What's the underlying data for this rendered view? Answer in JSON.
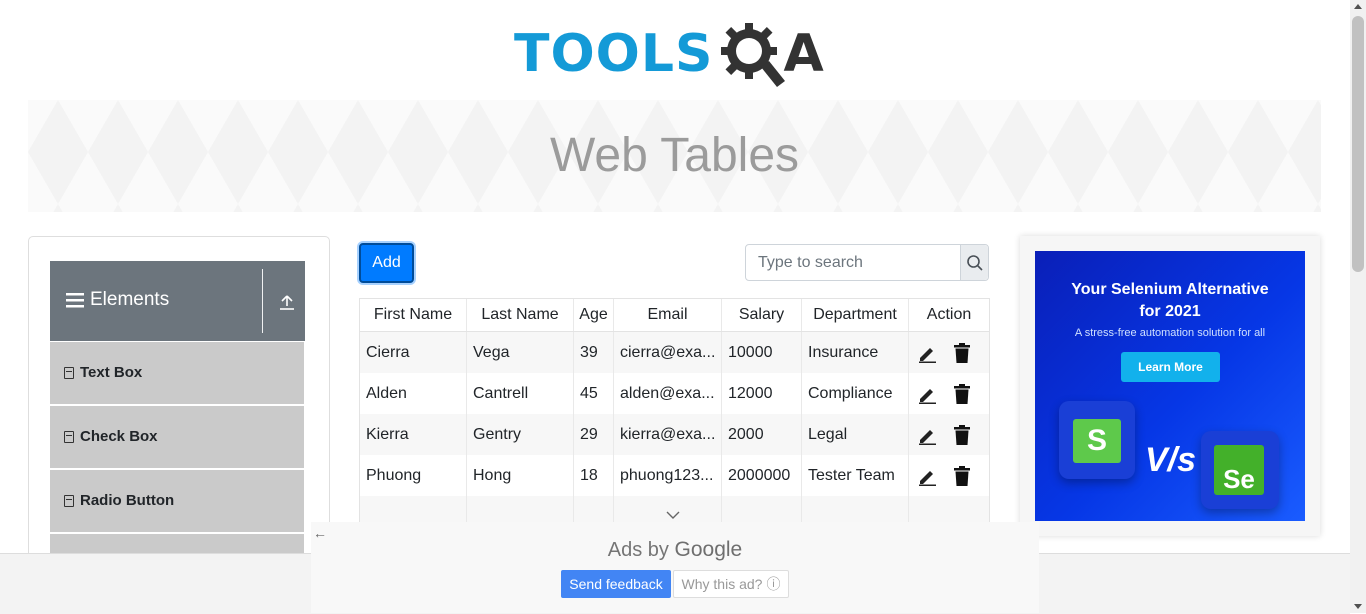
{
  "logo": {
    "part1": "TOOLS",
    "part2": "QA"
  },
  "banner": {
    "title": "Web Tables"
  },
  "sidebar": {
    "group_title": "Elements",
    "items": [
      {
        "label": "Text Box"
      },
      {
        "label": "Check Box"
      },
      {
        "label": "Radio Button"
      }
    ]
  },
  "toolbar": {
    "add_label": "Add",
    "search_placeholder": "Type to search"
  },
  "table": {
    "headers": [
      "First Name",
      "Last Name",
      "Age",
      "Email",
      "Salary",
      "Department",
      "Action"
    ],
    "rows": [
      [
        "Cierra",
        "Vega",
        "39",
        "cierra@exa...",
        "10000",
        "Insurance"
      ],
      [
        "Alden",
        "Cantrell",
        "45",
        "alden@exa...",
        "12000",
        "Compliance"
      ],
      [
        "Kierra",
        "Gentry",
        "29",
        "kierra@exa...",
        "2000",
        "Legal"
      ],
      [
        "Phuong",
        "Hong",
        "18",
        "phuong123...",
        "2000000",
        "Tester Team"
      ]
    ]
  },
  "ad": {
    "headline_1": "Your Selenium Alternative",
    "headline_2": "for 2021",
    "subline": "A stress-free automation solution for all",
    "cta": "Learn More",
    "vs": "V/s",
    "logo_left": "S",
    "logo_right": "Se"
  },
  "google_ads": {
    "ads_by": "Ads by",
    "brand": "Google",
    "send_feedback": "Send feedback",
    "why_this_ad": "Why this ad?",
    "why_icon": "ⓘ"
  },
  "colors": {
    "primary": "#007bff",
    "group_header": "#6c757d",
    "menu_item": "#cacaca",
    "logo_blue": "#149ad7"
  }
}
